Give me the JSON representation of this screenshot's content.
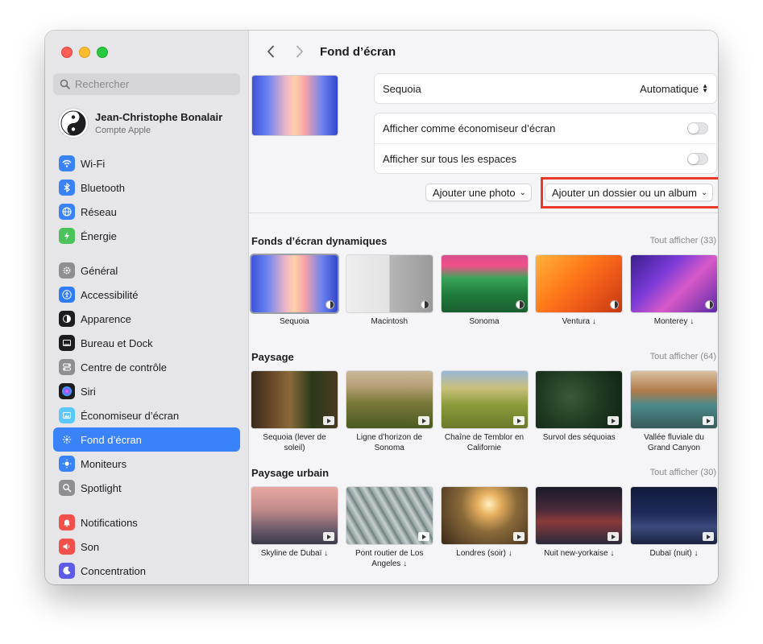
{
  "sidebar": {
    "search_placeholder": "Rechercher",
    "account": {
      "name": "Jean-Christophe Bonalair",
      "subtitle": "Compte Apple"
    },
    "items": [
      {
        "label": "Wi-Fi",
        "icon": "wifi-icon",
        "color": "#3a82f7"
      },
      {
        "label": "Bluetooth",
        "icon": "bluetooth-icon",
        "color": "#3a82f7"
      },
      {
        "label": "Réseau",
        "icon": "globe-icon",
        "color": "#3a82f7"
      },
      {
        "label": "Énergie",
        "icon": "battery-bolt-icon",
        "color": "#4cc25a"
      },
      {
        "label": "Général",
        "icon": "gear-icon",
        "color": "#8e8e93"
      },
      {
        "label": "Accessibilité",
        "icon": "accessibility-icon",
        "color": "#2f7cf6"
      },
      {
        "label": "Apparence",
        "icon": "appearance-icon",
        "color": "#1d1d1f"
      },
      {
        "label": "Bureau et Dock",
        "icon": "dock-icon",
        "color": "#1d1d1f"
      },
      {
        "label": "Centre de contrôle",
        "icon": "control-center-icon",
        "color": "#8e8e93"
      },
      {
        "label": "Siri",
        "icon": "siri-icon",
        "color": "#1d1d1f"
      },
      {
        "label": "Économiseur d’écran",
        "icon": "screensaver-icon",
        "color": "#5ac8fa"
      },
      {
        "label": "Fond d’écran",
        "icon": "wallpaper-icon",
        "color": "#3a82f7"
      },
      {
        "label": "Moniteurs",
        "icon": "display-icon",
        "color": "#3a82f7"
      },
      {
        "label": "Spotlight",
        "icon": "magnifier-icon",
        "color": "#8e8e93"
      },
      {
        "label": "Notifications",
        "icon": "bell-icon",
        "color": "#f2504a"
      },
      {
        "label": "Son",
        "icon": "speaker-icon",
        "color": "#f2504a"
      },
      {
        "label": "Concentration",
        "icon": "moon-icon",
        "color": "#5e5ce6"
      }
    ],
    "active_index": 11
  },
  "header": {
    "title": "Fond d’écran"
  },
  "wallpaper": {
    "current_name": "Sequoia",
    "mode": "Automatique",
    "screensaver_label": "Afficher comme économiseur d’écran",
    "screensaver_on": false,
    "all_spaces_label": "Afficher sur tous les espaces",
    "all_spaces_on": false,
    "add_photo_label": "Ajouter une photo",
    "add_folder_label": "Ajouter un dossier ou un album"
  },
  "sections": [
    {
      "title": "Fonds d’écran dynamiques",
      "see_all": "Tout afficher (33)",
      "items": [
        {
          "label": "Sequoia",
          "badge": "dynamic"
        },
        {
          "label": "Macintosh",
          "badge": "dynamic"
        },
        {
          "label": "Sonoma",
          "badge": "dynamic"
        },
        {
          "label": "Ventura ↓",
          "badge": "dynamic"
        },
        {
          "label": "Monterey ↓",
          "badge": "dynamic"
        }
      ]
    },
    {
      "title": "Paysage",
      "see_all": "Tout afficher (64)",
      "items": [
        {
          "label": "Sequoia (lever de soleil)",
          "badge": "video"
        },
        {
          "label": "Ligne d’horizon de Sonoma",
          "badge": "video"
        },
        {
          "label": "Chaîne de Temblor en Californie",
          "badge": "video"
        },
        {
          "label": "Survol des séquoias",
          "badge": "video"
        },
        {
          "label": "Vallée fluviale du Grand Canyon",
          "badge": "video"
        }
      ]
    },
    {
      "title": "Paysage urbain",
      "see_all": "Tout afficher (30)",
      "items": [
        {
          "label": "Skyline de Dubaï ↓",
          "badge": "video"
        },
        {
          "label": "Pont routier de Los Angeles ↓",
          "badge": "video"
        },
        {
          "label": "Londres (soir) ↓",
          "badge": "video"
        },
        {
          "label": "Nuit new-yorkaise ↓",
          "badge": "video"
        },
        {
          "label": "Dubaï (nuit) ↓",
          "badge": "video"
        }
      ]
    }
  ],
  "colors": {
    "accent": "#3a82f7",
    "highlight_box": "#e8392b"
  }
}
